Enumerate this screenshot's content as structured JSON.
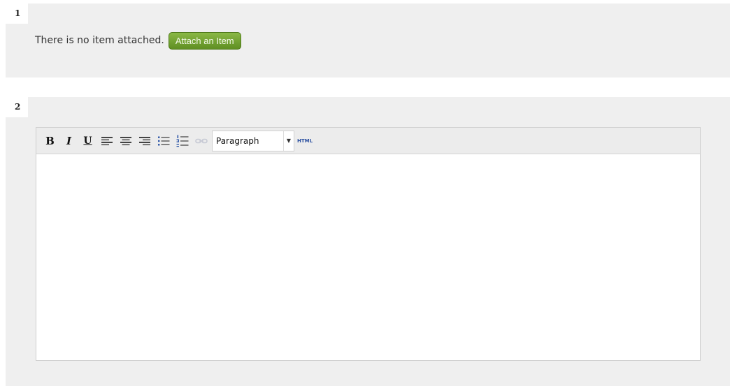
{
  "step1": {
    "number": "1",
    "attachment_status": "There is no item attached.",
    "attach_button_label": "Attach an Item"
  },
  "step2": {
    "number": "2",
    "toolbar": {
      "bold_label": "B",
      "italic_label": "I",
      "underline_label": "U",
      "format_select_value": "Paragraph",
      "html_button_label": "HTML"
    },
    "editor_content": ""
  },
  "colors": {
    "panel_background": "#efefef",
    "attach_button": "#6f9e2e",
    "html_link": "#2a4fa0"
  }
}
